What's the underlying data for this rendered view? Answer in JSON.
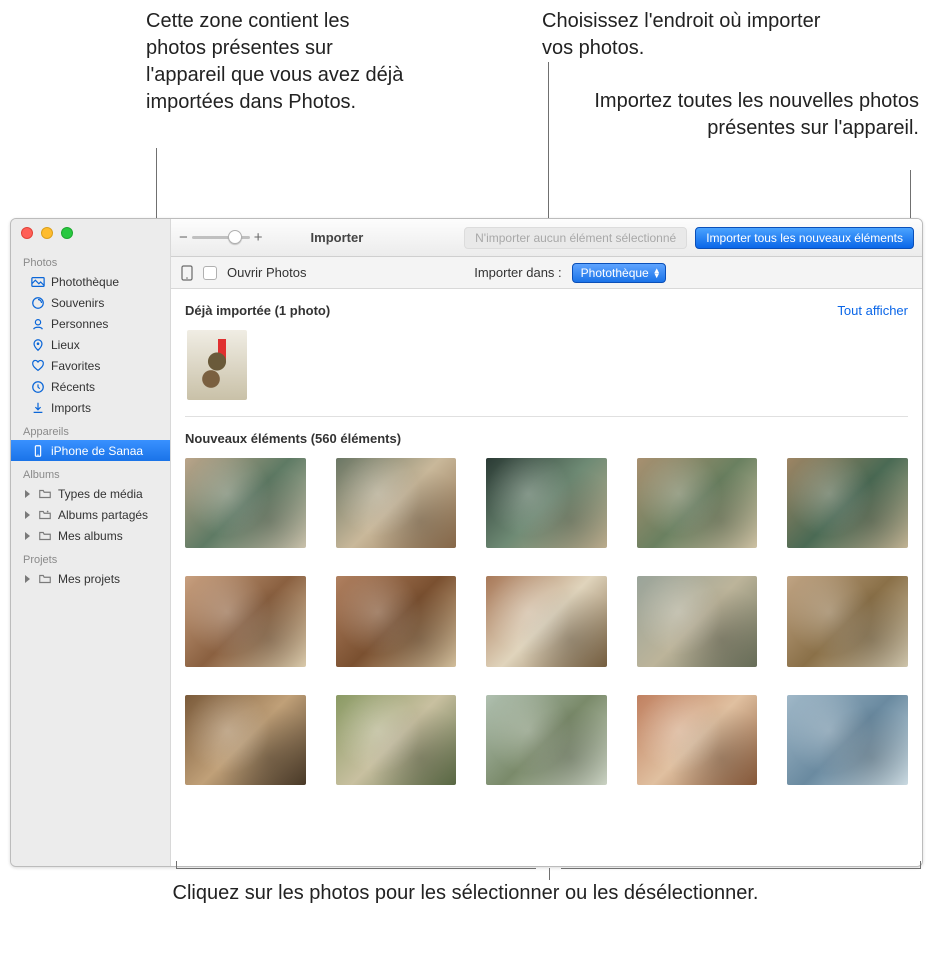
{
  "callouts": {
    "already_imported": "Cette zone contient les photos présentes sur l'appareil que vous avez déjà importées dans Photos.",
    "import_to_location": "Choisissez l'endroit où importer vos photos.",
    "import_all_new": "Importez toutes les nouvelles photos présentes sur l'appareil.",
    "click_select": "Cliquez sur les photos pour les sélectionner ou les désélectionner."
  },
  "toolbar": {
    "title": "Importer",
    "import_selected_disabled": "N'importer aucun élément sélectionné",
    "import_all_new": "Importer tous les nouveaux éléments"
  },
  "subbar": {
    "open_photos_checkbox": "Ouvrir Photos",
    "import_to_label": "Importer dans :",
    "import_to_value": "Photothèque"
  },
  "sidebar": {
    "section_photos": "Photos",
    "items_photos": [
      {
        "icon": "library",
        "label": "Photothèque"
      },
      {
        "icon": "memories",
        "label": "Souvenirs"
      },
      {
        "icon": "people",
        "label": "Personnes"
      },
      {
        "icon": "places",
        "label": "Lieux"
      },
      {
        "icon": "heart",
        "label": "Favorites"
      },
      {
        "icon": "clock",
        "label": "Récents"
      },
      {
        "icon": "import",
        "label": "Imports"
      }
    ],
    "section_devices": "Appareils",
    "device_item": {
      "icon": "phone",
      "label": "iPhone de Sanaa"
    },
    "section_albums": "Albums",
    "items_albums": [
      {
        "label": "Types de média"
      },
      {
        "label": "Albums partagés"
      },
      {
        "label": "Mes albums"
      }
    ],
    "section_projects": "Projets",
    "items_projects": [
      {
        "label": "Mes projets"
      }
    ]
  },
  "content": {
    "already_imported_header": "Déjà importée (1 photo)",
    "show_all": "Tout afficher",
    "new_items_header": "Nouveaux éléments (560 éléments)"
  }
}
